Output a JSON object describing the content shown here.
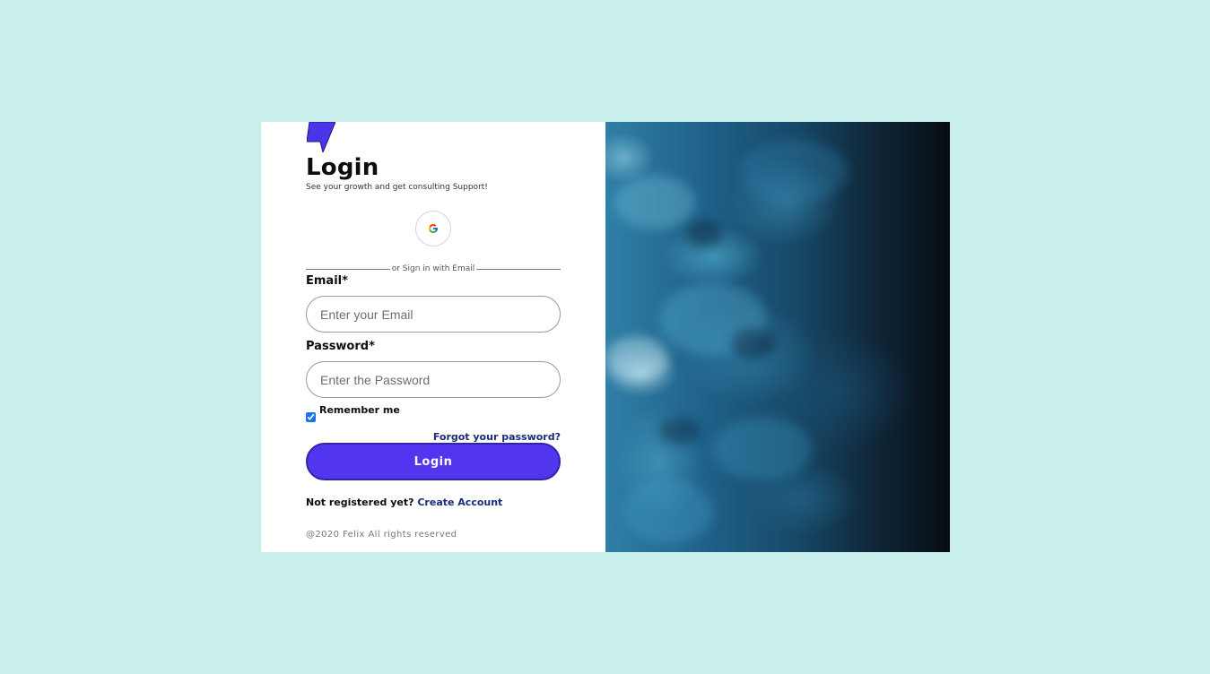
{
  "login": {
    "title": "Login",
    "subtitle": "See your growth and get consulting Support!",
    "google_icon": "google-g-icon",
    "divider_text": "or Sign in with Email",
    "email_label": "Email*",
    "email_placeholder": "Enter your Email",
    "email_value": "",
    "password_label": "Password*",
    "password_placeholder": "Enter the Password",
    "password_value": "",
    "remember_label": "Remember me",
    "remember_checked": true,
    "forgot_link": "Forgot your password?",
    "login_button": "Login",
    "not_registered": "Not registered yet?",
    "create_account": "Create Account",
    "footer": "@2020 Felix All rights reserved"
  },
  "colors": {
    "background": "#c9efec",
    "accent": "#5135ef",
    "link": "#1b2a7a"
  }
}
